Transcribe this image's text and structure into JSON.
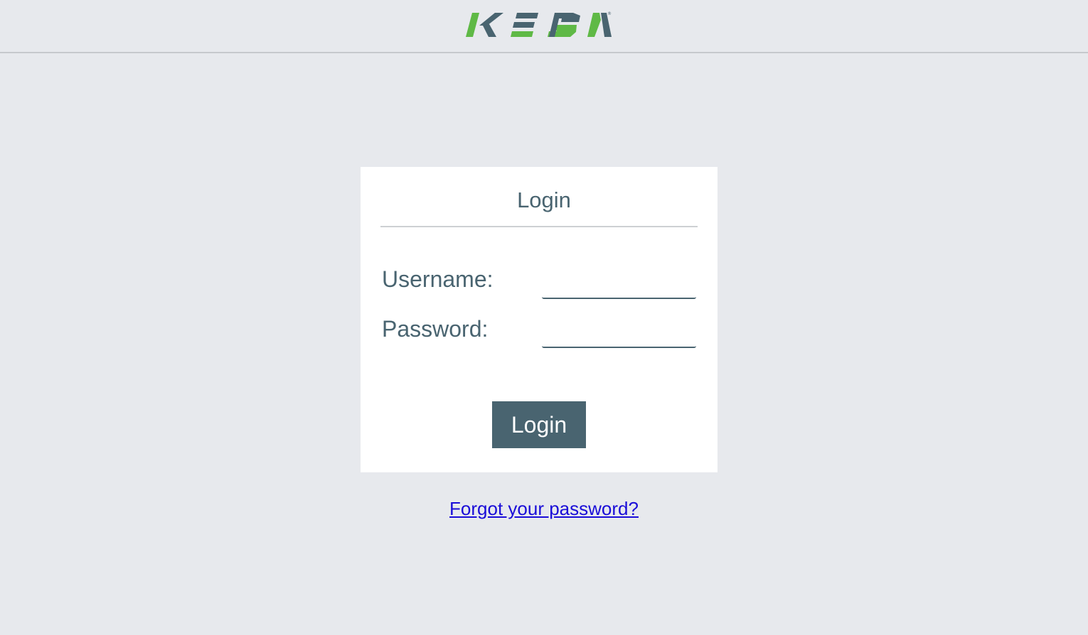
{
  "header": {
    "logo_text": "KEBA",
    "logo_mark": "®"
  },
  "login_card": {
    "title": "Login",
    "username_label": "Username:",
    "username_value": "",
    "password_label": "Password:",
    "password_value": "",
    "submit_label": "Login"
  },
  "forgot_link": "Forgot your password?",
  "colors": {
    "background": "#e7e9ed",
    "brand_green": "#5fb946",
    "brand_slate": "#496470",
    "link": "#1a0dd8"
  }
}
